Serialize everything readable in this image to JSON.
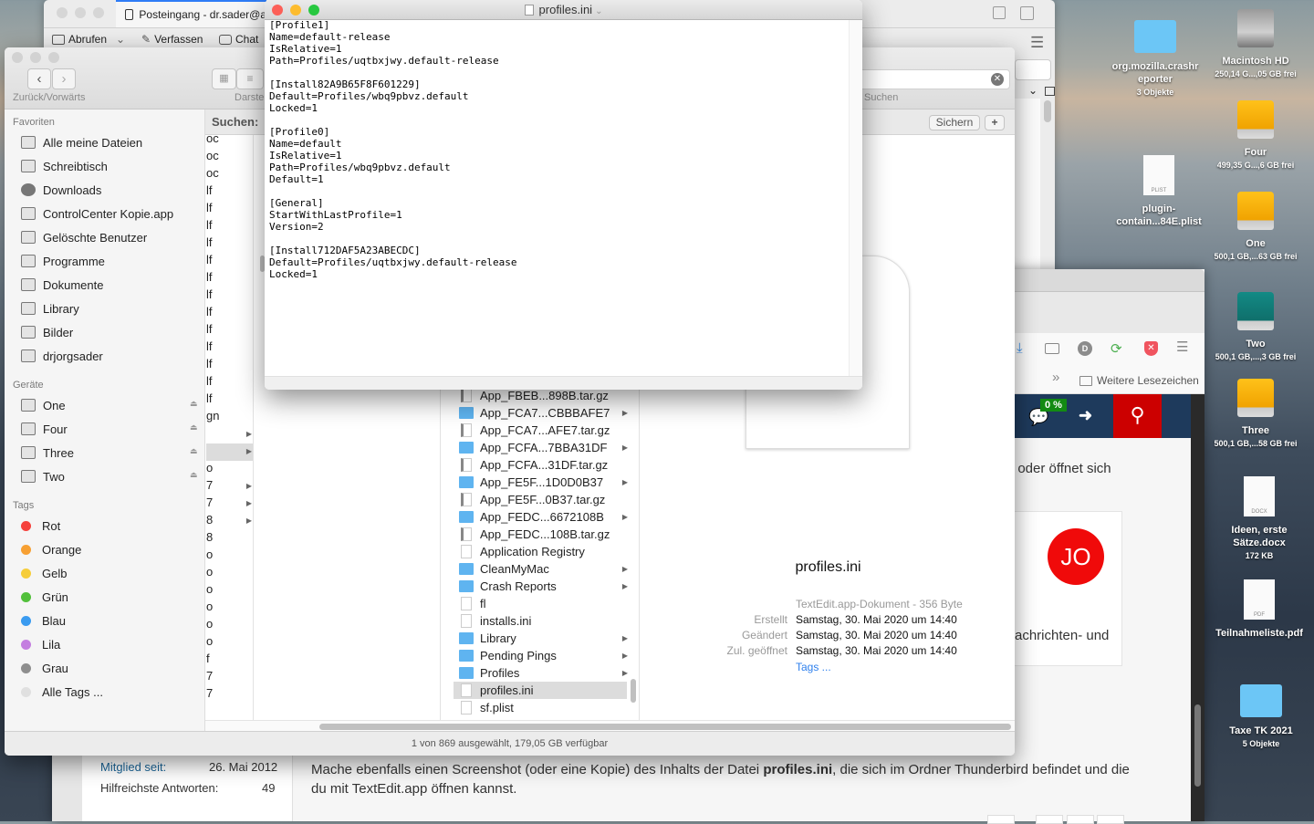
{
  "mail": {
    "tab_title": "Posteingang - dr.sader@a",
    "toolbar": {
      "get": "Abrufen",
      "compose": "Verfassen",
      "chat": "Chat"
    }
  },
  "textedit": {
    "title": "profiles.ini",
    "lines": [
      "[Profile1]",
      "Name=default-release",
      "IsRelative=1",
      "Path=Profiles/uqtbxjwy.default-release",
      "",
      "[Install82A9B65F8F601229]",
      "Default=Profiles/wbq9pbvz.default",
      "Locked=1",
      "",
      "[Profile0]",
      "Name=default",
      "IsRelative=1",
      "Path=Profiles/wbq9pbvz.default",
      "Default=1",
      "",
      "[General]",
      "StartWithLastProfile=1",
      "Version=2",
      "",
      "[Install712DAF5A23ABECDC]",
      "Default=Profiles/uqtbxjwy.default-release",
      "Locked=1"
    ]
  },
  "finder": {
    "nav_label": "Zurück/Vorwärts",
    "view_label": "Darste",
    "search_label": "Suchen",
    "search_scope": "Suchen:",
    "save_button": "Sichern",
    "add_button": "+",
    "status": "1 von 869 ausgewählt, 179,05 GB verfügbar",
    "sidebar": {
      "favorites_header": "Favoriten",
      "favorites": [
        "Alle meine Dateien",
        "Schreibtisch",
        "Downloads",
        "ControlCenter Kopie.app",
        "Gelöschte Benutzer",
        "Programme",
        "Dokumente",
        "Library",
        "Bilder",
        "drjorgsader"
      ],
      "devices_header": "Geräte",
      "devices": [
        "One",
        "Four",
        "Three",
        "Two"
      ],
      "tags_header": "Tags",
      "tags": [
        {
          "label": "Rot",
          "color": "#f5413c"
        },
        {
          "label": "Orange",
          "color": "#f7a033"
        },
        {
          "label": "Gelb",
          "color": "#f6cd3a"
        },
        {
          "label": "Grün",
          "color": "#52c03b"
        },
        {
          "label": "Blau",
          "color": "#3a9bf0"
        },
        {
          "label": "Lila",
          "color": "#c47ee0"
        },
        {
          "label": "Grau",
          "color": "#8e8e8e"
        },
        {
          "label": "Alle Tags ...",
          "color": "#e0e0e0"
        }
      ]
    },
    "partial_column": [
      "oc",
      "oc",
      "oc",
      "lf",
      "lf",
      "lf",
      "lf",
      "lf",
      "lf",
      "lf",
      "lf",
      "lf",
      "lf",
      "lf",
      "lf",
      "lf",
      "gn",
      "",
      "",
      "o",
      "7",
      "7",
      "8",
      "8",
      "o",
      "o",
      "o",
      "o",
      "o",
      "o",
      "f",
      "7",
      "7"
    ],
    "files": [
      {
        "name": "App_FBEB...898B.tar.gz",
        "kind": "arch"
      },
      {
        "name": "App_FCA7...CBBBAFE7",
        "kind": "folder"
      },
      {
        "name": "App_FCA7...AFE7.tar.gz",
        "kind": "arch"
      },
      {
        "name": "App_FCFA...7BBA31DF",
        "kind": "folder"
      },
      {
        "name": "App_FCFA...31DF.tar.gz",
        "kind": "arch"
      },
      {
        "name": "App_FE5F...1D0D0B37",
        "kind": "folder"
      },
      {
        "name": "App_FE5F...0B37.tar.gz",
        "kind": "arch"
      },
      {
        "name": "App_FEDC...6672108B",
        "kind": "folder"
      },
      {
        "name": "App_FEDC...108B.tar.gz",
        "kind": "arch"
      },
      {
        "name": "Application Registry",
        "kind": "doc"
      },
      {
        "name": "CleanMyMac",
        "kind": "folder"
      },
      {
        "name": "Crash Reports",
        "kind": "folder"
      },
      {
        "name": "fl",
        "kind": "doc"
      },
      {
        "name": "installs.ini",
        "kind": "doc"
      },
      {
        "name": "Library",
        "kind": "folder"
      },
      {
        "name": "Pending Pings",
        "kind": "folder"
      },
      {
        "name": "Profiles",
        "kind": "folder"
      },
      {
        "name": "profiles.ini",
        "kind": "doc",
        "selected": true
      },
      {
        "name": "sf.plist",
        "kind": "doc"
      }
    ],
    "preview": {
      "name": "profiles.ini",
      "kind": "TextEdit.app-Dokument - 356 Byte",
      "rows": [
        {
          "label": "Erstellt",
          "value": "Samstag, 30. Mai 2020 um 14:40"
        },
        {
          "label": "Geändert",
          "value": "Samstag, 30. Mai 2020 um 14:40"
        },
        {
          "label": "Zul. geöffnet",
          "value": "Samstag, 30. Mai 2020 um 14:40"
        }
      ],
      "tags_link": "Tags ..."
    }
  },
  "browser": {
    "bookmarks_overflow": "»",
    "bookmarks_folder": "Weitere Lesezeichen",
    "badge": "0 %",
    "extension_letter": "D",
    "text_partial_1": "; oder öffnet sich",
    "text_partial_2": "achrichten- und",
    "avatar": "JO",
    "member_since_label": "Mitglied seit:",
    "member_since_value": "26. Mai 2012",
    "helpful_label": "Hilfreichste Antworten:",
    "helpful_value": "49",
    "post_text_1": "Mache ebenfalls einen Screenshot (oder eine Kopie) des Inhalts der Datei ",
    "post_bold": "profiles.ini",
    "post_text_2": ", die sich im Ordner Thunderbird befindet und die",
    "post_text_3": "du mit TextEdit.app öffnen kannst."
  },
  "desktop": [
    {
      "name": "org.mozilla.crashr eporter",
      "sub": "3 Objekte",
      "icon": "folder"
    },
    {
      "name": "Macintosh HD",
      "sub": "250,14 G...,05 GB frei",
      "icon": "hdd"
    },
    {
      "name": "Four",
      "sub": "499,35 G...,6 GB frei",
      "icon": "drive"
    },
    {
      "name": "plugin-contain...84E.plist",
      "sub": "",
      "icon": "PLIST"
    },
    {
      "name": "One",
      "sub": "500,1 GB,...63 GB frei",
      "icon": "drive"
    },
    {
      "name": "Two",
      "sub": "500,1 GB,...,3 GB frei",
      "icon": "timemachine"
    },
    {
      "name": "Three",
      "sub": "500,1 GB,...58 GB frei",
      "icon": "drive"
    },
    {
      "name": "Ideen, erste Sätze.docx",
      "sub": "172 KB",
      "icon": "DOCX"
    },
    {
      "name": "Teilnahmeliste.pdf",
      "sub": "",
      "icon": "PDF"
    },
    {
      "name": "Taxe TK 2021",
      "sub": "5 Objekte",
      "icon": "folder"
    }
  ]
}
